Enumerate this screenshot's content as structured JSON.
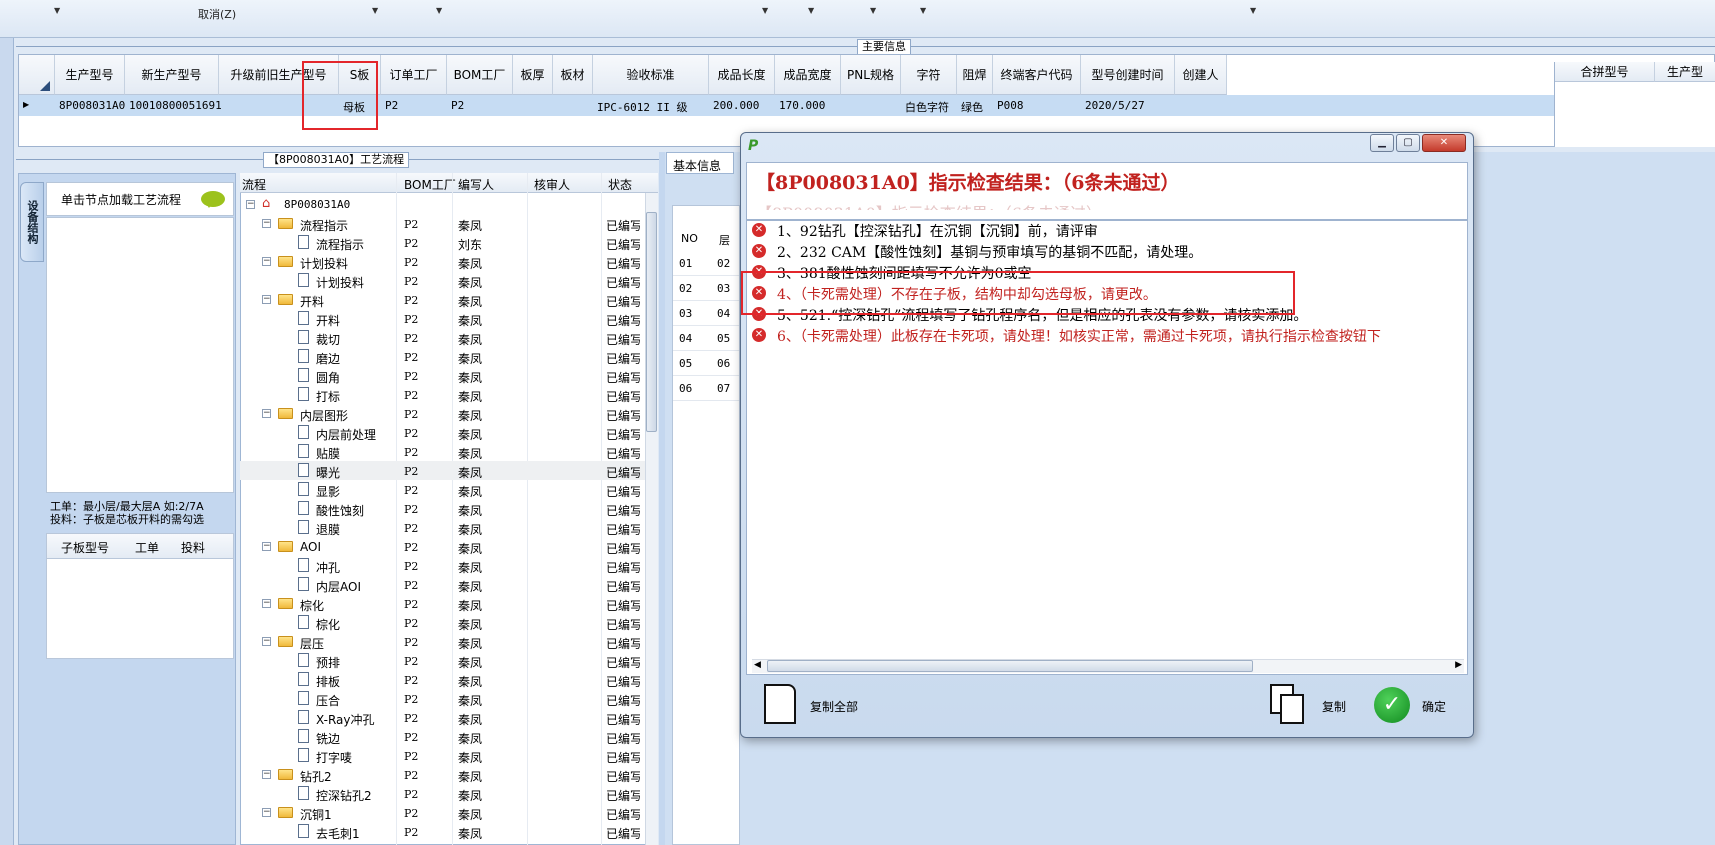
{
  "toolbar": {
    "cancel_label": "取消(Z)"
  },
  "section_main": "主要信息",
  "main_grid": {
    "headers": [
      "生产型号",
      "新生产型号",
      "升级前旧生产型号",
      "S板",
      "订单工厂",
      "BOM工厂",
      "板厚",
      "板材",
      "验收标准",
      "成品长度",
      "成品宽度",
      "PNL规格",
      "字符",
      "阻焊",
      "终端客户代码",
      "型号创建时间",
      "创建人"
    ],
    "row": [
      "8P008031A0",
      "10010800051691",
      "",
      "母板",
      "P2",
      "P2",
      "",
      "",
      "IPC-6012 II 级",
      "200.000",
      "170.000",
      "",
      "白色字符",
      "绿色",
      "P008",
      "2020/5/27",
      ""
    ],
    "right_headers": [
      "合拼型号",
      "生产型"
    ]
  },
  "process_panel_title": "【8P008031A0】工艺流程",
  "left_nav": {
    "vertical_tab": "设备结构",
    "tip": "单击节点加载工艺流程",
    "note_line1": "工单：最小层/最大层A 如:2/7A",
    "note_line2": "投料：子板是芯板开料的需勾选",
    "sub_headers": [
      "子板型号",
      "工单",
      "投料"
    ]
  },
  "process_headers": [
    "流程",
    "BOM工厂",
    "编写人",
    "核审人",
    "状态"
  ],
  "process_root": "8P008031A0",
  "process_rows": [
    {
      "name": "流程指示",
      "type": "folder",
      "bom": "P2",
      "editor": "秦凤",
      "status": "已编写"
    },
    {
      "name": "流程指示",
      "type": "doc",
      "bom": "P2",
      "editor": "刘东",
      "status": "已编写"
    },
    {
      "name": "计划投料",
      "type": "folder",
      "bom": "P2",
      "editor": "秦凤",
      "status": "已编写"
    },
    {
      "name": "计划投料",
      "type": "doc",
      "bom": "P2",
      "editor": "秦凤",
      "status": "已编写"
    },
    {
      "name": "开料",
      "type": "folder",
      "bom": "P2",
      "editor": "秦凤",
      "status": "已编写"
    },
    {
      "name": "开料",
      "type": "doc",
      "bom": "P2",
      "editor": "秦凤",
      "status": "已编写"
    },
    {
      "name": "裁切",
      "type": "doc",
      "bom": "P2",
      "editor": "秦凤",
      "status": "已编写"
    },
    {
      "name": "磨边",
      "type": "doc",
      "bom": "P2",
      "editor": "秦凤",
      "status": "已编写"
    },
    {
      "name": "圆角",
      "type": "doc",
      "bom": "P2",
      "editor": "秦凤",
      "status": "已编写"
    },
    {
      "name": "打标",
      "type": "doc",
      "bom": "P2",
      "editor": "秦凤",
      "status": "已编写"
    },
    {
      "name": "内层图形",
      "type": "folder",
      "bom": "P2",
      "editor": "秦凤",
      "status": "已编写"
    },
    {
      "name": "内层前处理",
      "type": "doc",
      "bom": "P2",
      "editor": "秦凤",
      "status": "已编写"
    },
    {
      "name": "贴膜",
      "type": "doc",
      "bom": "P2",
      "editor": "秦凤",
      "status": "已编写"
    },
    {
      "name": "曝光",
      "type": "doc",
      "bom": "P2",
      "editor": "秦凤",
      "status": "已编写"
    },
    {
      "name": "显影",
      "type": "doc",
      "bom": "P2",
      "editor": "秦凤",
      "status": "已编写"
    },
    {
      "name": "酸性蚀刻",
      "type": "doc",
      "bom": "P2",
      "editor": "秦凤",
      "status": "已编写"
    },
    {
      "name": "退膜",
      "type": "doc",
      "bom": "P2",
      "editor": "秦凤",
      "status": "已编写"
    },
    {
      "name": "AOI",
      "type": "folder",
      "bom": "P2",
      "editor": "秦凤",
      "status": "已编写"
    },
    {
      "name": "冲孔",
      "type": "doc",
      "bom": "P2",
      "editor": "秦凤",
      "status": "已编写"
    },
    {
      "name": "内层AOI",
      "type": "doc",
      "bom": "P2",
      "editor": "秦凤",
      "status": "已编写"
    },
    {
      "name": "棕化",
      "type": "folder",
      "bom": "P2",
      "editor": "秦凤",
      "status": "已编写"
    },
    {
      "name": "棕化",
      "type": "doc",
      "bom": "P2",
      "editor": "秦凤",
      "status": "已编写"
    },
    {
      "name": "层压",
      "type": "folder",
      "bom": "P2",
      "editor": "秦凤",
      "status": "已编写"
    },
    {
      "name": "预排",
      "type": "doc",
      "bom": "P2",
      "editor": "秦凤",
      "status": "已编写"
    },
    {
      "name": "排板",
      "type": "doc",
      "bom": "P2",
      "editor": "秦凤",
      "status": "已编写"
    },
    {
      "name": "压合",
      "type": "doc",
      "bom": "P2",
      "editor": "秦凤",
      "status": "已编写"
    },
    {
      "name": "X-Ray冲孔",
      "type": "doc",
      "bom": "P2",
      "editor": "秦凤",
      "status": "已编写"
    },
    {
      "name": "铣边",
      "type": "doc",
      "bom": "P2",
      "editor": "秦凤",
      "status": "已编写"
    },
    {
      "name": "打字唛",
      "type": "doc",
      "bom": "P2",
      "editor": "秦凤",
      "status": "已编写"
    },
    {
      "name": "钻孔2",
      "type": "folder",
      "bom": "P2",
      "editor": "秦凤",
      "status": "已编写"
    },
    {
      "name": "控深钻孔2",
      "type": "doc",
      "bom": "P2",
      "editor": "秦凤",
      "status": "已编写"
    },
    {
      "name": "沉铜1",
      "type": "folder",
      "bom": "P2",
      "editor": "秦凤",
      "status": "已编写"
    },
    {
      "name": "去毛刺1",
      "type": "doc",
      "bom": "P2",
      "editor": "秦凤",
      "status": "已编写"
    }
  ],
  "right_panel": {
    "tab": "基本信息",
    "table_header": [
      "NO",
      "层"
    ],
    "rows": [
      [
        "01",
        "02"
      ],
      [
        "02",
        "03"
      ],
      [
        "03",
        "04"
      ],
      [
        "04",
        "05"
      ],
      [
        "05",
        "06"
      ],
      [
        "06",
        "07"
      ]
    ]
  },
  "dialog": {
    "title": "【8P008031A0】指示检查结果：（6条未通过）",
    "messages": [
      "1、92钻孔【控深钻孔】在沉铜【沉铜】前，请评审",
      "2、232 CAM【酸性蚀刻】基铜与预审填写的基铜不匹配，请处理。",
      "3、381酸性蚀刻间距填写不允许为0或空",
      "4、（卡死需处理）不存在子板，结构中却勾选母板，请更改。",
      "5、521.“控深钻孔”流程填写了钻孔程序名，但是相应的孔表没有参数，请核实添加。",
      "6、（卡死需处理）此板存在卡死项，请处理！如核实正常，需通过卡死项，请执行指示检查按钮下"
    ],
    "message_colors": [
      "#000000",
      "#000000",
      "#000000",
      "#c1221f",
      "#000000",
      "#c1221f"
    ],
    "copy_all_label": "复制全部",
    "copy_label": "复制",
    "ok_label": "确定"
  }
}
